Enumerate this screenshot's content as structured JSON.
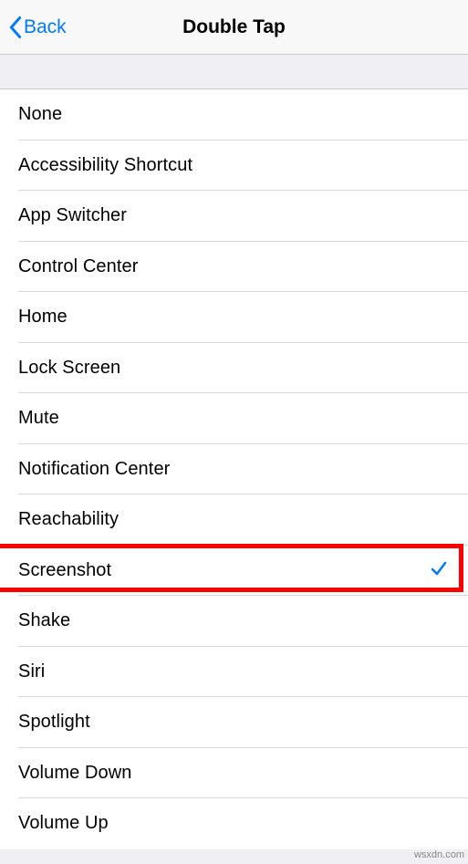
{
  "nav": {
    "back_label": "Back",
    "title": "Double Tap"
  },
  "options": [
    {
      "label": "None",
      "selected": false
    },
    {
      "label": "Accessibility Shortcut",
      "selected": false
    },
    {
      "label": "App Switcher",
      "selected": false
    },
    {
      "label": "Control Center",
      "selected": false
    },
    {
      "label": "Home",
      "selected": false
    },
    {
      "label": "Lock Screen",
      "selected": false
    },
    {
      "label": "Mute",
      "selected": false
    },
    {
      "label": "Notification Center",
      "selected": false
    },
    {
      "label": "Reachability",
      "selected": false
    },
    {
      "label": "Screenshot",
      "selected": true
    },
    {
      "label": "Shake",
      "selected": false
    },
    {
      "label": "Siri",
      "selected": false
    },
    {
      "label": "Spotlight",
      "selected": false
    },
    {
      "label": "Volume Down",
      "selected": false
    },
    {
      "label": "Volume Up",
      "selected": false
    }
  ],
  "watermark": "wsxdn.com"
}
